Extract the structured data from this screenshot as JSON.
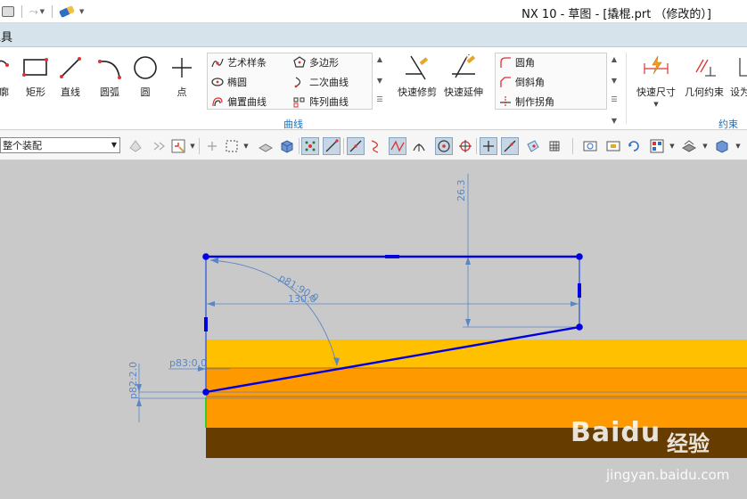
{
  "window": {
    "title": "NX 10 - 草图 - [撬棍.prt （修改的）]"
  },
  "tabbar": {
    "tab_label": "工具"
  },
  "ribbon": {
    "tools": [
      {
        "label": "轮廓",
        "icon": "profile-icon"
      },
      {
        "label": "矩形",
        "icon": "rectangle-icon"
      },
      {
        "label": "直线",
        "icon": "line-icon"
      },
      {
        "label": "圆弧",
        "icon": "arc-icon"
      },
      {
        "label": "圆",
        "icon": "circle-icon"
      },
      {
        "label": "点",
        "icon": "point-icon"
      }
    ],
    "curve_gallery": {
      "items": [
        "艺术样条",
        "多边形",
        "椭圆",
        "二次曲线",
        "偏置曲线",
        "阵列曲线"
      ],
      "group_label": "曲线"
    },
    "edit_tools": [
      {
        "label": "快速修剪",
        "icon": "quick-trim-icon"
      },
      {
        "label": "快速延伸",
        "icon": "quick-extend-icon"
      }
    ],
    "corner_gallery": {
      "items": [
        "圆角",
        "倒斜角",
        "制作拐角"
      ]
    },
    "constraint_tools": [
      {
        "label": "快速尺寸",
        "icon": "rapid-dimension-icon"
      },
      {
        "label": "几何约束",
        "icon": "geometric-constraint-icon"
      },
      {
        "label": "设为",
        "icon": "set-as-icon"
      }
    ],
    "constraint_group_label": "约束"
  },
  "toolbar2": {
    "assembly_select_value": "整个装配"
  },
  "sketch": {
    "dimensions": {
      "vertical_height": "26.3",
      "angle": "p81:90.0",
      "width": "130.0",
      "p83": "p83:0.0",
      "p82": "p82:2.0"
    },
    "colors": {
      "sketch_line": "#0000e0",
      "dimension": "#5b86c4",
      "band_yellow": "#ffc000",
      "band_orange": "#ff9900",
      "band_brown": "#663c00",
      "background": "#c9c9c9"
    }
  },
  "watermark": {
    "logo": "Baidu",
    "sub": "经验",
    "url": "jingyan.baidu.com"
  }
}
